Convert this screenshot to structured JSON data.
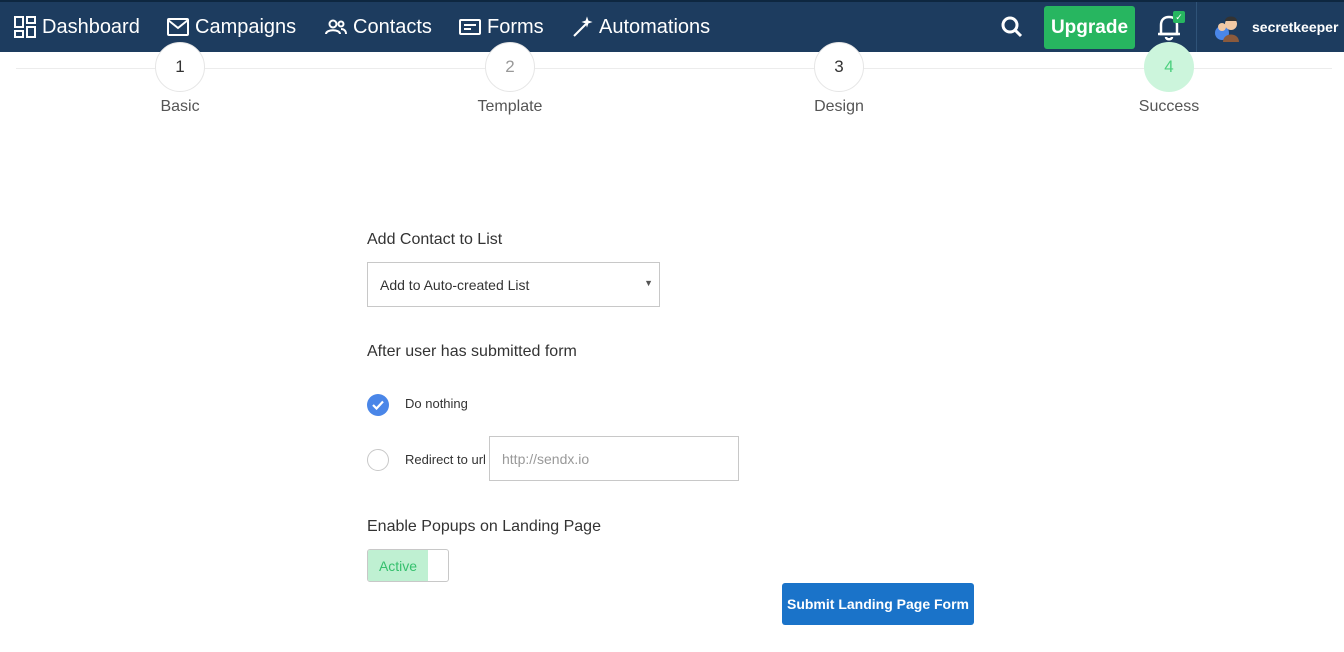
{
  "nav": {
    "items": [
      {
        "label": "Dashboard",
        "icon": "dashboard-icon"
      },
      {
        "label": "Campaigns",
        "icon": "envelope-icon"
      },
      {
        "label": "Contacts",
        "icon": "users-icon"
      },
      {
        "label": "Forms",
        "icon": "form-icon"
      },
      {
        "label": "Automations",
        "icon": "magic-wand-icon"
      }
    ],
    "upgrade_label": "Upgrade",
    "username": "secretkeeper"
  },
  "stepper": {
    "steps": [
      {
        "number": "1",
        "label": "Basic"
      },
      {
        "number": "2",
        "label": "Template"
      },
      {
        "number": "3",
        "label": "Design"
      },
      {
        "number": "4",
        "label": "Success"
      }
    ],
    "active_step": 4
  },
  "form": {
    "list_label": "Add Contact to List",
    "list_selected": "Add to Auto-created List",
    "after_label": "After user has submitted form",
    "option_nothing": "Do nothing",
    "option_redirect": "Redirect to url",
    "redirect_placeholder": "http://sendx.io",
    "popups_label": "Enable Popups on Landing Page",
    "popups_state": "Active",
    "submit_label": "Submit Landing Page Form"
  },
  "colors": {
    "topbar": "#1d3c5f",
    "upgrade": "#27b660",
    "active_step": "#ccf5dc",
    "radio_checked": "#4a86e8",
    "submit": "#1a73c9"
  }
}
